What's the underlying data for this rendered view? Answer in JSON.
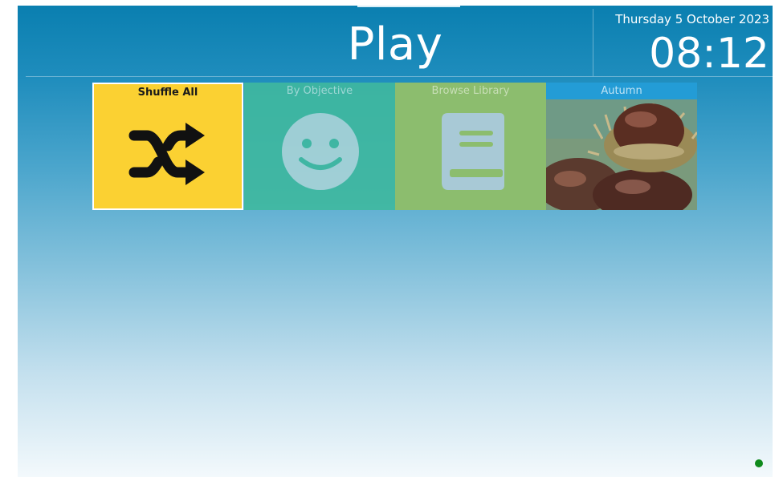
{
  "header": {
    "title": "Play",
    "date": "Thursday 5 October 2023",
    "time": "08:12"
  },
  "tiles": [
    {
      "label": "Shuffle All",
      "icon": "shuffle-icon",
      "color": "#fbd132",
      "selected": true
    },
    {
      "label": "By Objective",
      "icon": "smiley-face-icon",
      "color": "#3fb8a0",
      "selected": false
    },
    {
      "label": "Browse Library",
      "icon": "book-icon",
      "color": "#8cbd6e",
      "selected": false
    },
    {
      "label": "Autumn",
      "icon": "conker-photo",
      "color": "#239cd6",
      "selected": false
    }
  ],
  "status": {
    "indicator_color": "#0f8a1c"
  }
}
